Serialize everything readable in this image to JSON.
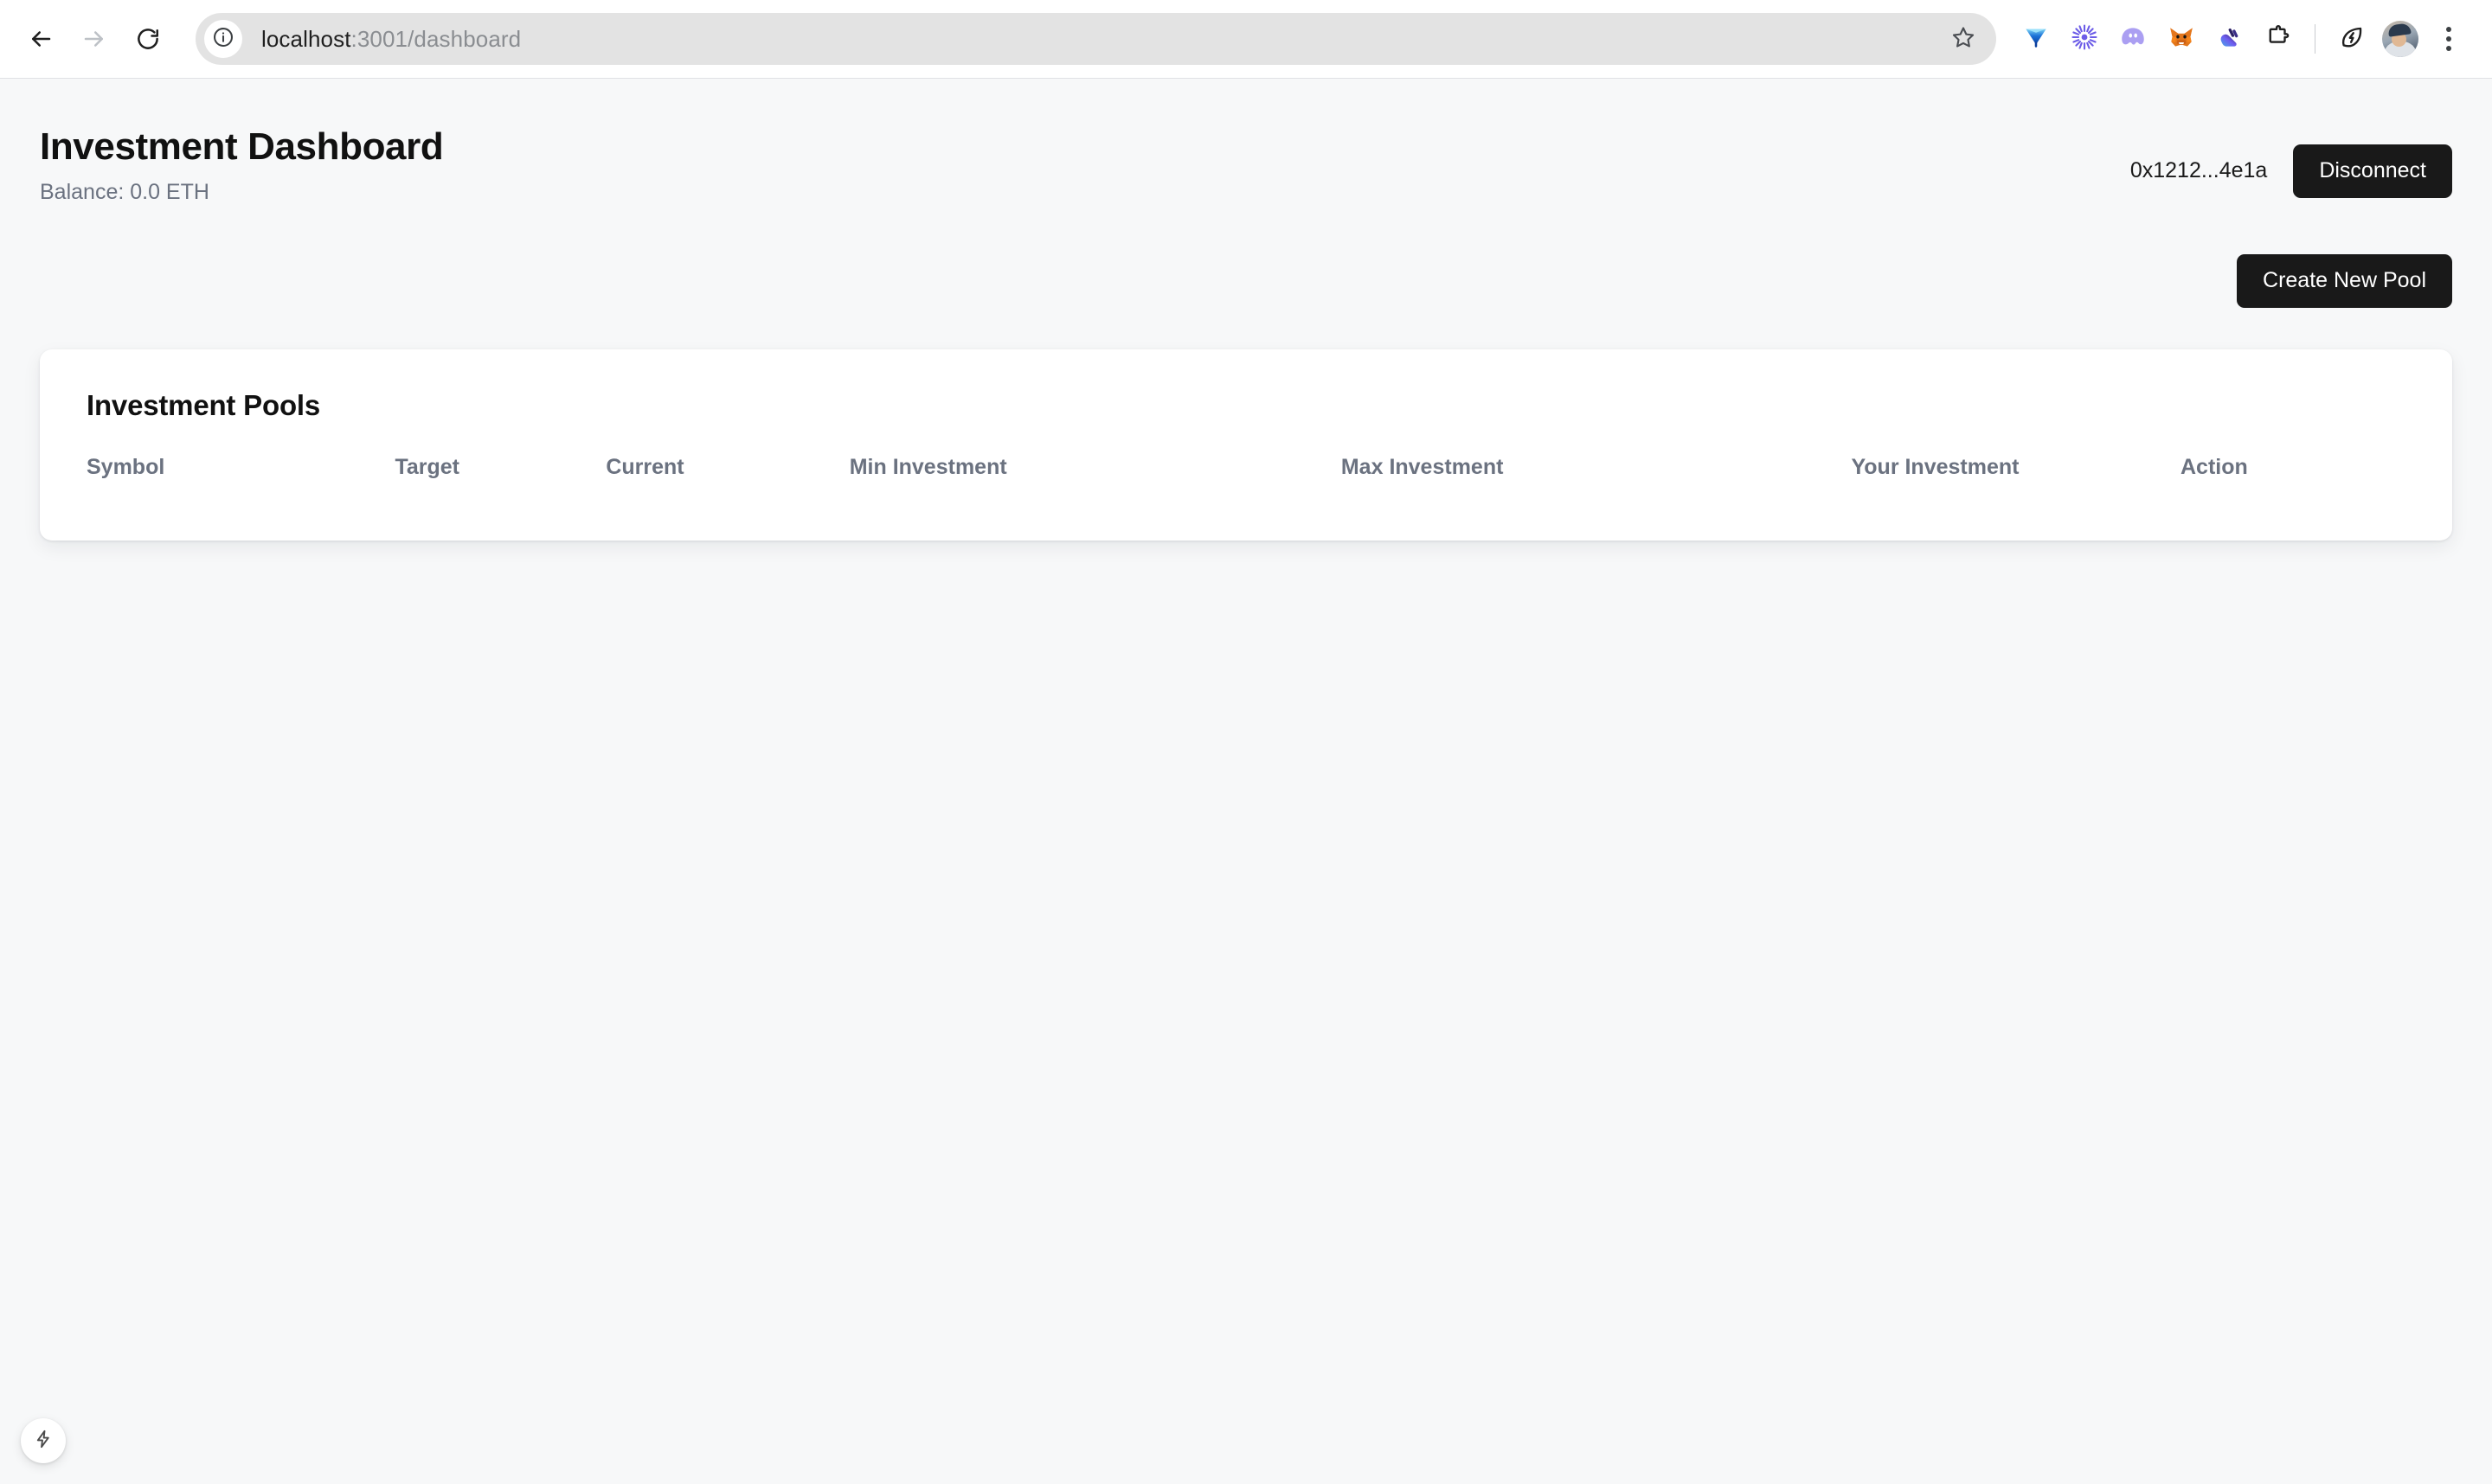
{
  "browser": {
    "nav": {
      "back_icon": "arrow-left-icon",
      "forward_icon": "arrow-right-icon",
      "reload_icon": "reload-icon"
    },
    "omnibox": {
      "site_info_icon": "info-circle-icon",
      "url_host": "localhost",
      "url_path": ":3001/dashboard",
      "bookmark_icon": "star-icon"
    },
    "extensions": [
      {
        "name": "gem-icon"
      },
      {
        "name": "sunburst-icon"
      },
      {
        "name": "ghost-icon"
      },
      {
        "name": "fox-icon"
      },
      {
        "name": "hand-wave-icon"
      },
      {
        "name": "puzzle-piece-icon"
      }
    ],
    "leaf_bolt_icon": "leaf-bolt-icon",
    "avatar": "profile-avatar",
    "menu_icon": "three-dot-menu-icon"
  },
  "header": {
    "title": "Investment Dashboard",
    "subtitle": "Balance: 0.0 ETH",
    "wallet_address": "0x1212...4e1a",
    "disconnect_label": "Disconnect"
  },
  "toolbar": {
    "create_pool_label": "Create New Pool"
  },
  "pools_card": {
    "title": "Investment Pools",
    "columns": [
      "Symbol",
      "Target",
      "Current",
      "Min Investment",
      "Max Investment",
      "Your Investment",
      "Action"
    ],
    "rows": []
  },
  "dev_indicator": {
    "icon": "lightning-bolt-icon"
  },
  "colors": {
    "page_background": "#f7f8f9",
    "card_background": "#ffffff",
    "button_dark": "#191919",
    "muted_text": "#6b7280",
    "title_text": "#111111"
  }
}
